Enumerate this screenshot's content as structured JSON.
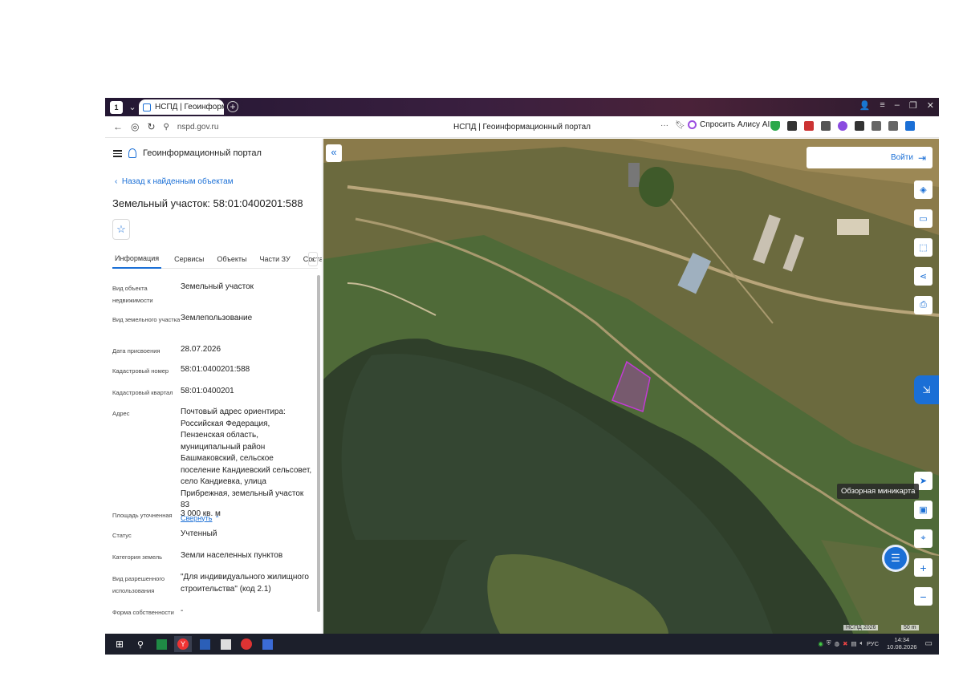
{
  "browser": {
    "tab_title": "НСПД | Геоинформаци",
    "url": "nspd.gov.ru",
    "page_title": "НСПД | Геоинформационный портал",
    "alice_label": "Спросить Алису AI"
  },
  "panel": {
    "portal_name": "Геоинформационный портал",
    "back_label": "Назад к найденным объектам",
    "title": "Земельный участок: 58:01:0400201:588",
    "tabs": [
      "Информация",
      "Сервисы",
      "Объекты",
      "Части ЗУ",
      "Состав"
    ],
    "fields": [
      {
        "key": "Вид объекта недвижимости",
        "value": "Земельный участок"
      },
      {
        "key": "Вид земельного участка",
        "value": "Землепользование"
      },
      {
        "key": "Дата присвоения",
        "value": "28.07.2026"
      },
      {
        "key": "Кадастровый номер",
        "value": "58:01:0400201:588"
      },
      {
        "key": "Кадастровый квартал",
        "value": "58:01:0400201"
      },
      {
        "key": "Адрес",
        "value": "Почтовый адрес ориентира: Российская Федерация, Пензенская область, муниципальный район Башмаковский, сельское поселение Кандиевский сельсовет, село Кандиевка, улица Прибрежная, земельный участок 83"
      },
      {
        "key": "Площадь уточненная",
        "value": "3 000 кв. м"
      },
      {
        "key": "Статус",
        "value": "Учтенный"
      },
      {
        "key": "Категория земель",
        "value": "Земли населенных пунктов"
      },
      {
        "key": "Вид разрешенного использования",
        "value": "\"Для индивидуального жилищного строительства\" (код 2.1)"
      },
      {
        "key": "Форма собственности",
        "value": "-"
      }
    ],
    "collapse_label": "Свернуть"
  },
  "map": {
    "login_label": "Войти",
    "minimap_tooltip": "Обзорная миникарта",
    "attribution": "НСПД 2026",
    "scale_label": "50 m",
    "parcel_color": "#c23bd4"
  },
  "taskbar": {
    "language": "РУС",
    "time": "14:34",
    "date": "10.08.2026"
  },
  "icons": [
    "search-icon",
    "star-icon",
    "layers-icon",
    "ruler-icon",
    "select-icon",
    "share-icon",
    "print-icon",
    "locate-icon",
    "minimap-icon",
    "pin-icon",
    "zoom-in-icon",
    "zoom-out-icon",
    "chat-icon",
    "windows-start-icon"
  ]
}
